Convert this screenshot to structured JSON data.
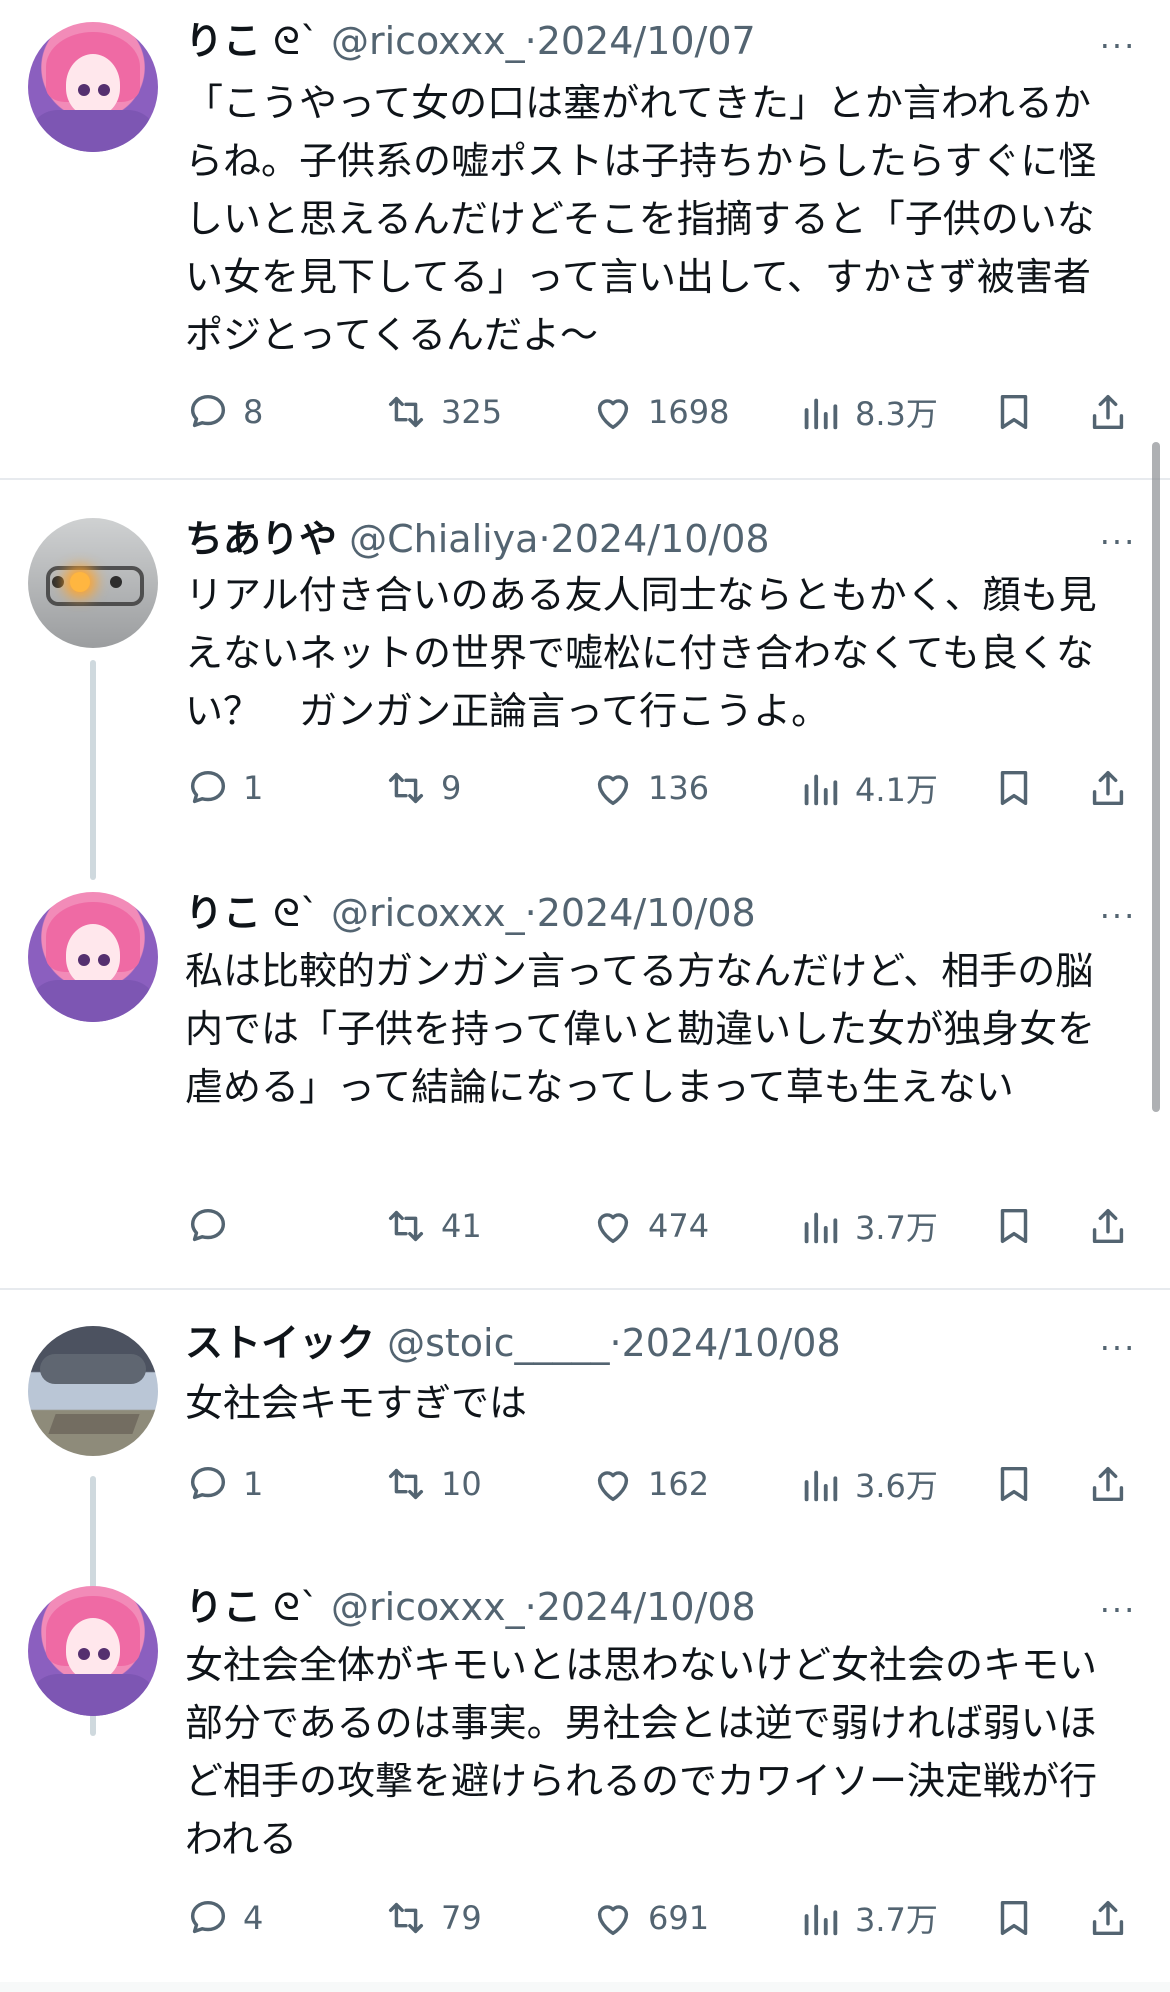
{
  "tweets": [
    {
      "name": "りこ",
      "handle": "@ricoxxx_",
      "date": "2024/10/07",
      "text": "「こうやって女の口は塞がれてきた」とか言われるからね。子供系の嘘ポストは子持ちからしたらすぐに怪しいと思えるんだけどそこを指摘すると「子供のいない女を見下してる」って言い出して、すかさず被害者ポジとってくるんだよ〜",
      "stats": {
        "replies": "8",
        "retweets": "325",
        "likes": "1698",
        "views": "8.3万"
      }
    },
    {
      "name": "ちありや",
      "handle": "@Chialiya",
      "date": "2024/10/08",
      "text": "リアル付き合いのある友人同士ならともかく、顔も見えないネットの世界で嘘松に付き合わなくても良くない？　ガンガン正論言って行こうよ。",
      "stats": {
        "replies": "1",
        "retweets": "9",
        "likes": "136",
        "views": "4.1万"
      }
    },
    {
      "name": "りこ",
      "handle": "@ricoxxx_",
      "date": "2024/10/08",
      "text": "私は比較的ガンガン言ってる方なんだけど、相手の脳内では「子供を持って偉いと勘違いした女が独身女を虐める」って結論になってしまって草も生えない",
      "stats": {
        "replies": "",
        "retweets": "41",
        "likes": "474",
        "views": "3.7万"
      }
    },
    {
      "name": "ストイック",
      "handle": "@stoic_____",
      "date": "2024/10/08",
      "text": "女社会キモすぎでは",
      "stats": {
        "replies": "1",
        "retweets": "10",
        "likes": "162",
        "views": "3.6万"
      }
    },
    {
      "name": "りこ",
      "handle": "@ricoxxx_",
      "date": "2024/10/08",
      "text": "女社会全体がキモいとは思わないけど女社会のキモい部分であるのは事実。男社会とは逆で弱ければ弱いほど相手の攻撃を避けられるのでカワイソー決定戦が行われる",
      "stats": {
        "replies": "4",
        "retweets": "79",
        "likes": "691",
        "views": "3.7万"
      }
    }
  ],
  "ui": {
    "more": "···",
    "dot": "·"
  }
}
